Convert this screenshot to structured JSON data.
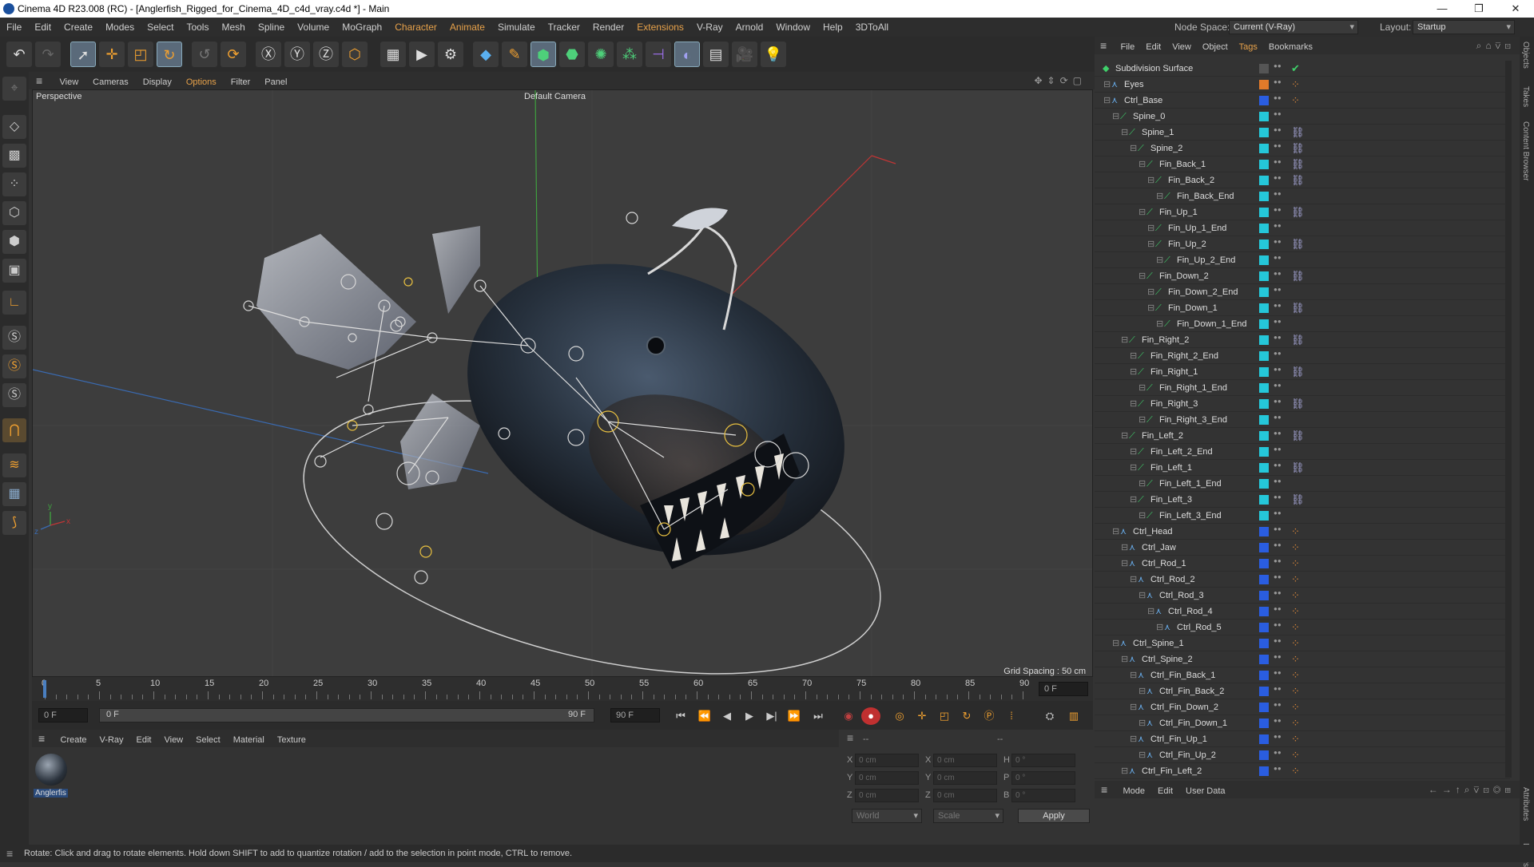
{
  "window": {
    "title": "Cinema 4D R23.008 (RC) - [Anglerfish_Rigged_for_Cinema_4D_c4d_vray.c4d *] - Main",
    "minimize": "—",
    "maximize": "❐",
    "close": "✕"
  },
  "menu": {
    "items": [
      "File",
      "Edit",
      "Create",
      "Modes",
      "Select",
      "Tools",
      "Mesh",
      "Spline",
      "Volume",
      "MoGraph",
      "Character",
      "Animate",
      "Simulate",
      "Tracker",
      "Render",
      "Extensions",
      "V-Ray",
      "Arnold",
      "Window",
      "Help",
      "3DToAll"
    ],
    "highlighted": [
      "Character",
      "Animate",
      "Extensions"
    ],
    "node_space_label": "Node Space:",
    "node_space_value": "Current (V-Ray)",
    "layout_label": "Layout:",
    "layout_value": "Startup"
  },
  "viewport": {
    "menu": [
      "View",
      "Cameras",
      "Display",
      "Options",
      "Filter",
      "Panel"
    ],
    "highlighted": "Options",
    "name": "Perspective",
    "camera": "Default Camera",
    "grid_spacing": "Grid Spacing : 50 cm",
    "axis_y": "y",
    "axis_z": "z",
    "axis_x": "x"
  },
  "timeline": {
    "ticks": [
      "0",
      "5",
      "10",
      "15",
      "20",
      "25",
      "30",
      "35",
      "40",
      "45",
      "50",
      "55",
      "60",
      "65",
      "70",
      "75",
      "80",
      "85",
      "90"
    ],
    "frame_end_field": "0 F"
  },
  "transport": {
    "start": "0 F",
    "current": "0 F",
    "range_end": "90 F",
    "end": "90 F"
  },
  "materials": {
    "menu": [
      "Create",
      "V-Ray",
      "Edit",
      "View",
      "Select",
      "Material",
      "Texture"
    ],
    "items": [
      {
        "name": "Anglerfis"
      }
    ]
  },
  "coords": {
    "header_a": "--",
    "header_b": "--",
    "x": "0 cm",
    "y": "0 cm",
    "z": "0 cm",
    "x2": "0 cm",
    "y2": "0 cm",
    "z2": "0 cm",
    "h": "0 °",
    "p": "0 °",
    "b": "0 °",
    "world": "World",
    "scale": "Scale",
    "apply": "Apply",
    "labels": {
      "x": "X",
      "y": "Y",
      "z": "Z",
      "x2": "X",
      "y2": "Y",
      "z2": "Z",
      "h": "H",
      "p": "P",
      "b": "B"
    }
  },
  "objects": {
    "menu": [
      "File",
      "Edit",
      "View",
      "Object",
      "Tags",
      "Bookmarks"
    ],
    "highlighted": "Tags",
    "rows": [
      {
        "name": "Subdivision Surface",
        "depth": 0,
        "color": "#555",
        "kind": "sub"
      },
      {
        "name": "Eyes",
        "depth": 1,
        "color": "#e07a2a",
        "kind": "null"
      },
      {
        "name": "Ctrl_Base",
        "depth": 1,
        "color": "#2a5de0",
        "kind": "null"
      },
      {
        "name": "Spine_0",
        "depth": 2,
        "color": "#25c7d9",
        "kind": "joint"
      },
      {
        "name": "Spine_1",
        "depth": 3,
        "color": "#25c7d9",
        "kind": "joint"
      },
      {
        "name": "Spine_2",
        "depth": 4,
        "color": "#25c7d9",
        "kind": "joint"
      },
      {
        "name": "Fin_Back_1",
        "depth": 5,
        "color": "#25c7d9",
        "kind": "joint"
      },
      {
        "name": "Fin_Back_2",
        "depth": 6,
        "color": "#25c7d9",
        "kind": "joint"
      },
      {
        "name": "Fin_Back_End",
        "depth": 7,
        "color": "#25c7d9",
        "kind": "joint"
      },
      {
        "name": "Fin_Up_1",
        "depth": 5,
        "color": "#25c7d9",
        "kind": "joint"
      },
      {
        "name": "Fin_Up_1_End",
        "depth": 6,
        "color": "#25c7d9",
        "kind": "joint"
      },
      {
        "name": "Fin_Up_2",
        "depth": 6,
        "color": "#25c7d9",
        "kind": "joint"
      },
      {
        "name": "Fin_Up_2_End",
        "depth": 7,
        "color": "#25c7d9",
        "kind": "joint"
      },
      {
        "name": "Fin_Down_2",
        "depth": 5,
        "color": "#25c7d9",
        "kind": "joint"
      },
      {
        "name": "Fin_Down_2_End",
        "depth": 6,
        "color": "#25c7d9",
        "kind": "joint"
      },
      {
        "name": "Fin_Down_1",
        "depth": 6,
        "color": "#25c7d9",
        "kind": "joint"
      },
      {
        "name": "Fin_Down_1_End",
        "depth": 7,
        "color": "#25c7d9",
        "kind": "joint"
      },
      {
        "name": "Fin_Right_2",
        "depth": 3,
        "color": "#25c7d9",
        "kind": "joint"
      },
      {
        "name": "Fin_Right_2_End",
        "depth": 4,
        "color": "#25c7d9",
        "kind": "joint"
      },
      {
        "name": "Fin_Right_1",
        "depth": 4,
        "color": "#25c7d9",
        "kind": "joint"
      },
      {
        "name": "Fin_Right_1_End",
        "depth": 5,
        "color": "#25c7d9",
        "kind": "joint"
      },
      {
        "name": "Fin_Right_3",
        "depth": 4,
        "color": "#25c7d9",
        "kind": "joint"
      },
      {
        "name": "Fin_Right_3_End",
        "depth": 5,
        "color": "#25c7d9",
        "kind": "joint"
      },
      {
        "name": "Fin_Left_2",
        "depth": 3,
        "color": "#25c7d9",
        "kind": "joint"
      },
      {
        "name": "Fin_Left_2_End",
        "depth": 4,
        "color": "#25c7d9",
        "kind": "joint"
      },
      {
        "name": "Fin_Left_1",
        "depth": 4,
        "color": "#25c7d9",
        "kind": "joint"
      },
      {
        "name": "Fin_Left_1_End",
        "depth": 5,
        "color": "#25c7d9",
        "kind": "joint"
      },
      {
        "name": "Fin_Left_3",
        "depth": 4,
        "color": "#25c7d9",
        "kind": "joint"
      },
      {
        "name": "Fin_Left_3_End",
        "depth": 5,
        "color": "#25c7d9",
        "kind": "joint"
      },
      {
        "name": "Ctrl_Head",
        "depth": 2,
        "color": "#2a5de0",
        "kind": "null"
      },
      {
        "name": "Ctrl_Jaw",
        "depth": 3,
        "color": "#2a5de0",
        "kind": "null"
      },
      {
        "name": "Ctrl_Rod_1",
        "depth": 3,
        "color": "#2a5de0",
        "kind": "null"
      },
      {
        "name": "Ctrl_Rod_2",
        "depth": 4,
        "color": "#2a5de0",
        "kind": "null"
      },
      {
        "name": "Ctrl_Rod_3",
        "depth": 5,
        "color": "#2a5de0",
        "kind": "null"
      },
      {
        "name": "Ctrl_Rod_4",
        "depth": 6,
        "color": "#2a5de0",
        "kind": "null"
      },
      {
        "name": "Ctrl_Rod_5",
        "depth": 7,
        "color": "#2a5de0",
        "kind": "null"
      },
      {
        "name": "Ctrl_Spine_1",
        "depth": 2,
        "color": "#2a5de0",
        "kind": "null"
      },
      {
        "name": "Ctrl_Spine_2",
        "depth": 3,
        "color": "#2a5de0",
        "kind": "null"
      },
      {
        "name": "Ctrl_Fin_Back_1",
        "depth": 4,
        "color": "#2a5de0",
        "kind": "null"
      },
      {
        "name": "Ctrl_Fin_Back_2",
        "depth": 5,
        "color": "#2a5de0",
        "kind": "null"
      },
      {
        "name": "Ctrl_Fin_Down_2",
        "depth": 4,
        "color": "#2a5de0",
        "kind": "null"
      },
      {
        "name": "Ctrl_Fin_Down_1",
        "depth": 5,
        "color": "#2a5de0",
        "kind": "null"
      },
      {
        "name": "Ctrl_Fin_Up_1",
        "depth": 4,
        "color": "#2a5de0",
        "kind": "null"
      },
      {
        "name": "Ctrl_Fin_Up_2",
        "depth": 5,
        "color": "#2a5de0",
        "kind": "null"
      },
      {
        "name": "Ctrl_Fin_Left_2",
        "depth": 3,
        "color": "#2a5de0",
        "kind": "null"
      }
    ]
  },
  "attributes": {
    "menu": [
      "Mode",
      "Edit",
      "User Data"
    ]
  },
  "side_tabs": [
    "Objects",
    "Takes",
    "Content Browser",
    "Attributes",
    "Layers"
  ],
  "status": "Rotate: Click and drag to rotate elements. Hold down SHIFT to add to quantize rotation / add to the selection in point mode, CTRL to remove."
}
